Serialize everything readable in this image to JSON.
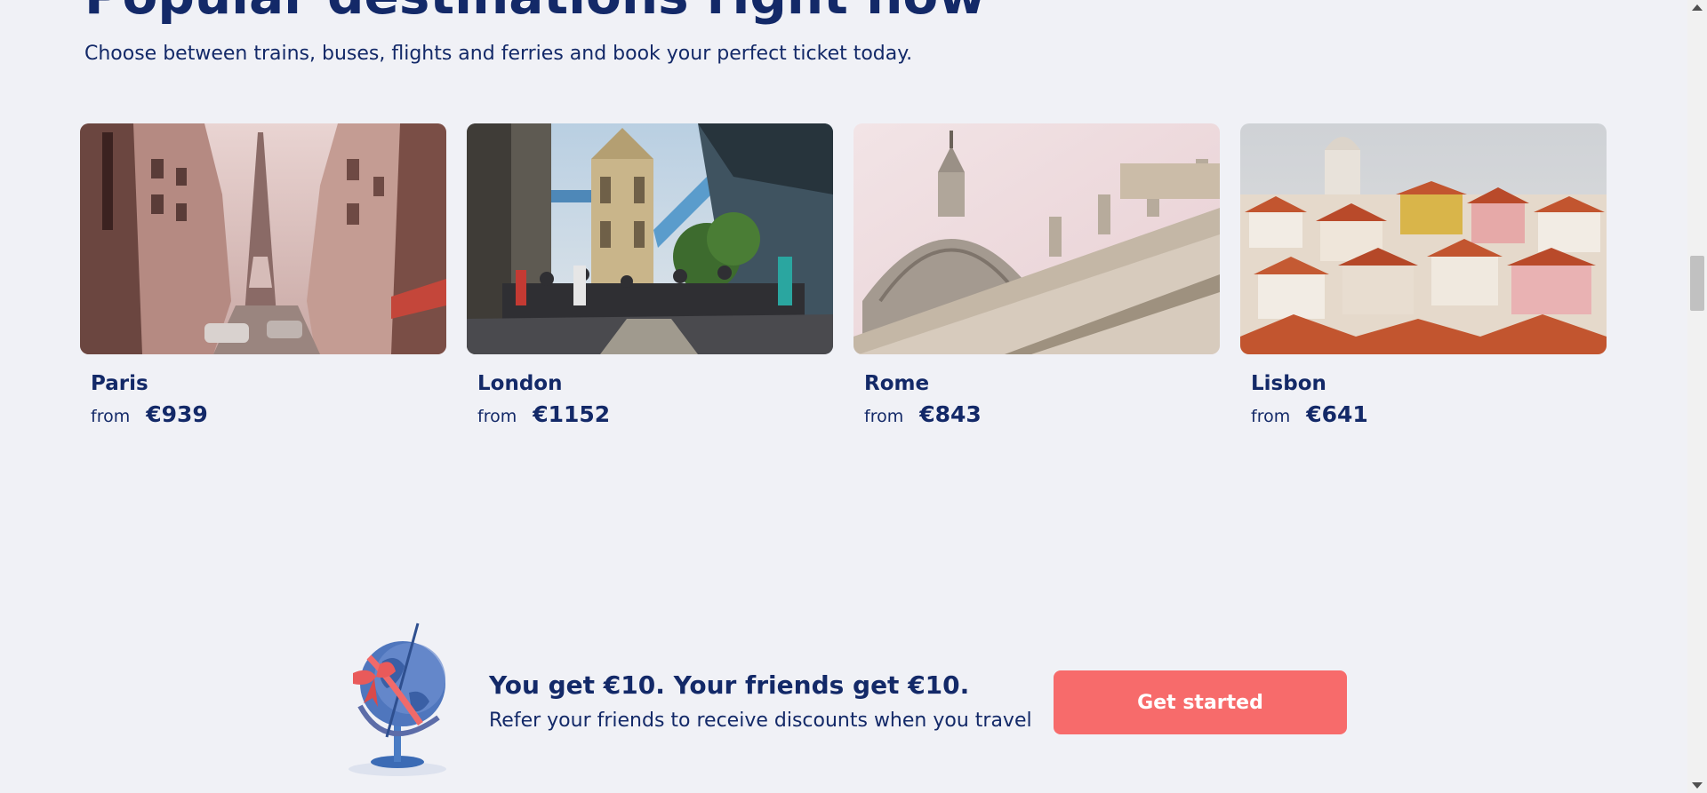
{
  "section": {
    "title": "Popular destinations right now",
    "subtitle": "Choose between trains, buses, flights and ferries and book your perfect ticket today."
  },
  "destinations": [
    {
      "city": "Paris",
      "from_label": "from",
      "price": "€939",
      "image_icon": "paris-street-eiffel-tower"
    },
    {
      "city": "London",
      "from_label": "from",
      "price": "€1152",
      "image_icon": "london-tower-bridge"
    },
    {
      "city": "Rome",
      "from_label": "from",
      "price": "€843",
      "image_icon": "rome-st-peters-dome"
    },
    {
      "city": "Lisbon",
      "from_label": "from",
      "price": "€641",
      "image_icon": "lisbon-rooftops"
    }
  ],
  "referral": {
    "title": "You get €10. Your friends get €10.",
    "text": "Refer your friends to receive discounts when you travel",
    "button_label": "Get started",
    "illustration_icon": "globe-with-ribbon-icon"
  },
  "colors": {
    "background": "#f0f1f6",
    "text": "#132968",
    "button": "#f76b6b",
    "button_text": "#ffffff"
  }
}
